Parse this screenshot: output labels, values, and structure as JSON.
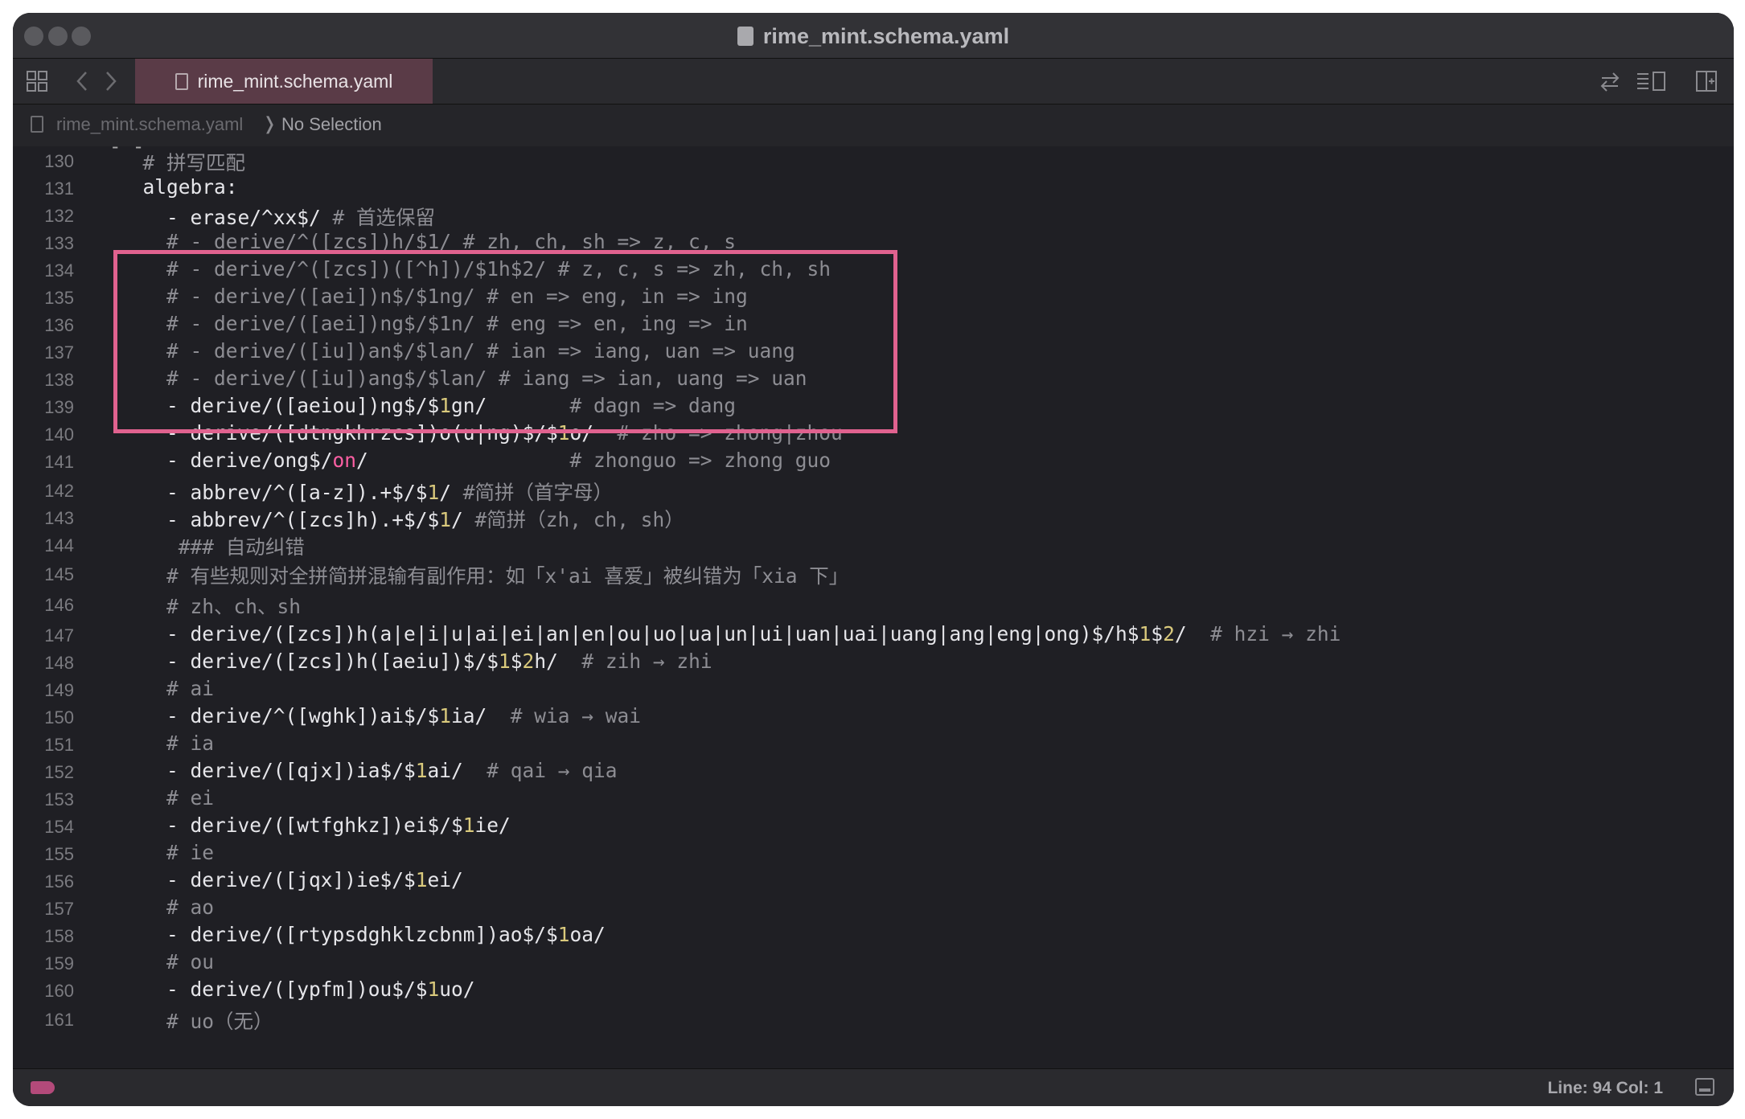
{
  "window": {
    "title": "rime_mint.schema.yaml"
  },
  "tabbar": {
    "tab_label": "rime_mint.schema.yaml",
    "icons": [
      "grid-icon",
      "back-chevron-icon",
      "forward-chevron-icon",
      "swap-arrows-icon",
      "split-view-icon",
      "add-editor-icon"
    ]
  },
  "breadcrumb": {
    "file": "rime_mint.schema.yaml",
    "separator": "❭",
    "selection": "No Selection"
  },
  "highlight_color": "#e0628f",
  "editor": {
    "lines": [
      {
        "num": "130",
        "text": "  # 拼写匹配"
      },
      {
        "num": "131",
        "text": "  algebra:"
      },
      {
        "num": "132",
        "text": "    - erase/^xx$/ # 首选保留"
      },
      {
        "num": "133",
        "text": "    # - derive/^([zcs])h/$1/ # zh, ch, sh => z, c, s"
      },
      {
        "num": "134",
        "text": "    # - derive/^([zcs])([^h])/$1h$2/ # z, c, s => zh, ch, sh"
      },
      {
        "num": "135",
        "text": "    # - derive/([aei])n$/$1ng/ # en => eng, in => ing"
      },
      {
        "num": "136",
        "text": "    # - derive/([aei])ng$/$1n/ # eng => en, ing => in"
      },
      {
        "num": "137",
        "text": "    # - derive/([iu])an$/$lan/ # ian => iang, uan => uang"
      },
      {
        "num": "138",
        "text": "    # - derive/([iu])ang$/$lan/ # iang => ian, uang => uan"
      },
      {
        "num": "139",
        "text": "    - derive/([aeiou])ng$/$1gn/       # dagn => dang"
      },
      {
        "num": "140",
        "text": "    - derive/([dtngkhrzcs])o(u|ng)$/$1o/  # zho => zhong|zhou"
      },
      {
        "num": "141",
        "text": "    - derive/ong$/on/                 # zhonguo => zhong guo"
      },
      {
        "num": "142",
        "text": "    - abbrev/^([a-z]).+$/$1/ #简拼（首字母）"
      },
      {
        "num": "143",
        "text": "    - abbrev/^([zcs]h).+$/$1/ #简拼（zh, ch, sh）"
      },
      {
        "num": "144",
        "text": "     ### 自动纠错"
      },
      {
        "num": "145",
        "text": "    # 有些规则对全拼简拼混输有副作用：如「x'ai 喜爱」被纠错为「xia 下」"
      },
      {
        "num": "146",
        "text": "    # zh、ch、sh"
      },
      {
        "num": "147",
        "text": "    - derive/([zcs])h(a|e|i|u|ai|ei|an|en|ou|uo|ua|un|ui|uan|uai|uang|ang|eng|ong)$/h$1$2/  # hzi → zhi"
      },
      {
        "num": "148",
        "text": "    - derive/([zcs])h([aeiu])$/$1$2h/  # zih → zhi"
      },
      {
        "num": "149",
        "text": "    # ai"
      },
      {
        "num": "150",
        "text": "    - derive/^([wghk])ai$/$1ia/  # wia → wai"
      },
      {
        "num": "151",
        "text": "    # ia"
      },
      {
        "num": "152",
        "text": "    - derive/([qjx])ia$/$1ai/  # qai → qia"
      },
      {
        "num": "153",
        "text": "    # ei"
      },
      {
        "num": "154",
        "text": "    - derive/([wtfghkz])ei$/$1ie/"
      },
      {
        "num": "155",
        "text": "    # ie"
      },
      {
        "num": "156",
        "text": "    - derive/([jqx])ie$/$1ei/"
      },
      {
        "num": "157",
        "text": "    # ao"
      },
      {
        "num": "158",
        "text": "    - derive/([rtypsdghklzcbnm])ao$/$1oa/"
      },
      {
        "num": "159",
        "text": "    # ou"
      },
      {
        "num": "160",
        "text": "    - derive/([ypfm])ou$/$1uo/"
      },
      {
        "num": "161",
        "text": "    # uo（无）"
      }
    ]
  },
  "status": {
    "position": "Line: 94  Col: 1"
  }
}
